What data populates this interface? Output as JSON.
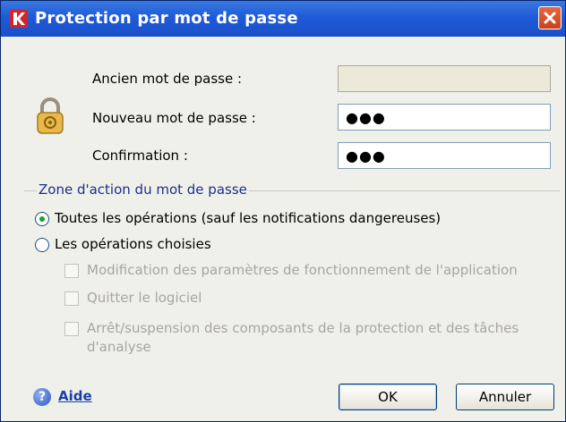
{
  "window": {
    "title": "Protection par mot de passe",
    "titlebar_color": "#1f5ad8",
    "close_icon": "close-x"
  },
  "fields": {
    "old_label": "Ancien mot de passe :",
    "old_value": "",
    "new_label": "Nouveau mot de passe :",
    "new_value": "●●●",
    "confirm_label": "Confirmation :",
    "confirm_value": "●●●"
  },
  "scope": {
    "group_label": "Zone d'action du mot de passe",
    "radio_all": "Toutes les opérations (sauf les notifications dangereuses)",
    "radio_all_selected": true,
    "radio_chosen": "Les opérations choisies",
    "options": [
      {
        "label": "Modification des paramètres de fonctionnement de l'application",
        "checked": false,
        "enabled": false
      },
      {
        "label": "Quitter le logiciel",
        "checked": false,
        "enabled": false
      },
      {
        "label_line1": "Arrêt/suspension des composants de la protection  et des tâches",
        "label_line2": "d'analyse",
        "checked": false,
        "enabled": false
      }
    ]
  },
  "footer": {
    "help_label": "Aide",
    "help_icon": "?",
    "ok_label": "OK",
    "cancel_label": "Annuler"
  }
}
